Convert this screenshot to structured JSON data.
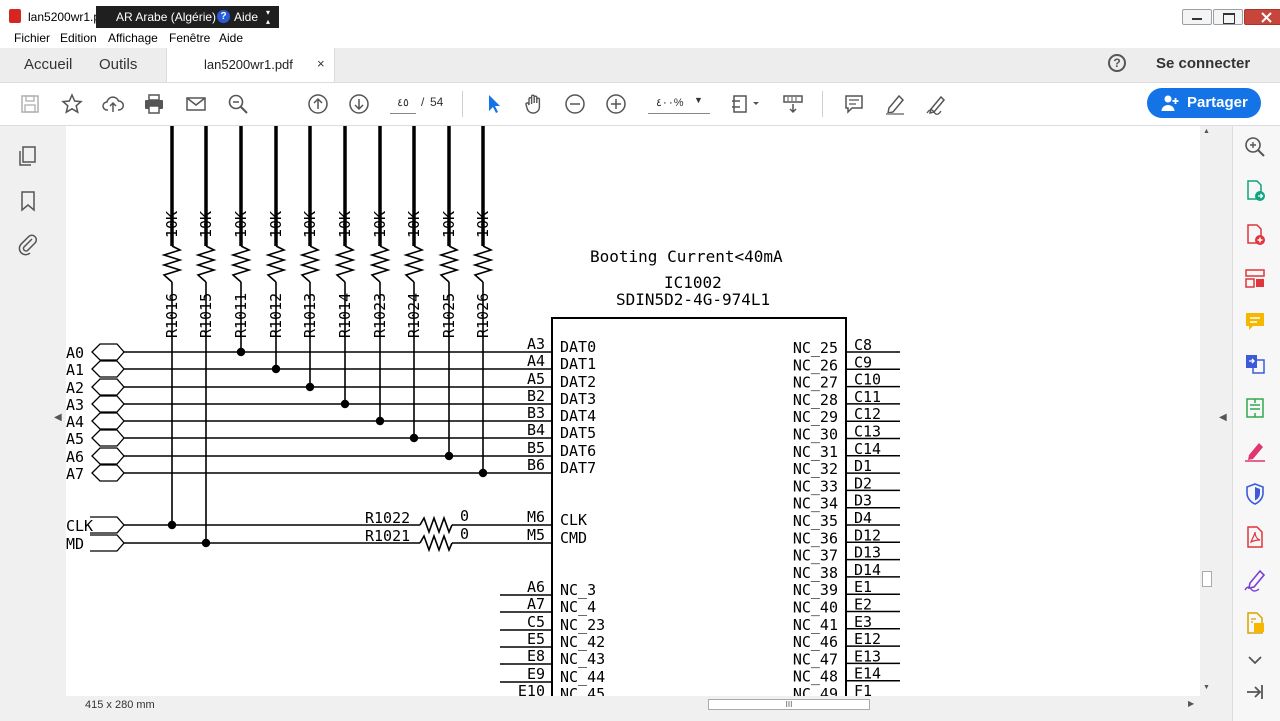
{
  "window": {
    "title": "lan5200wr1.pdf",
    "ime": {
      "language": "AR Arabe (Algérie)",
      "help": "Aide"
    }
  },
  "menu": [
    "Fichier",
    "Edition",
    "Affichage",
    "Fenêtre",
    "Aide"
  ],
  "tabs": {
    "home": "Accueil",
    "tools": "Outils",
    "document": "lan5200wr1.pdf",
    "close": "×"
  },
  "header": {
    "help": "?",
    "signin": "Se connecter"
  },
  "toolbar": {
    "page_current": "٤٥",
    "page_separator": "/",
    "page_total": "54",
    "zoom": "٤٠٠%",
    "share_label": "Partager"
  },
  "status": {
    "page_size": "415 x 280 mm",
    "hscroll_grip": "III"
  },
  "colors": {
    "accent": "#1473e6",
    "close": "#c6463c"
  },
  "schematic": {
    "note": "Booting Current<40mA",
    "ic_ref": "IC1002",
    "ic_part": "SDIN5D2-4G-974L1",
    "resistor_value": "10K",
    "pullups": [
      "R1016",
      "R1015",
      "R1011",
      "R1012",
      "R1013",
      "R1014",
      "R1023",
      "R1024",
      "R1025",
      "R1026"
    ],
    "net_labels": [
      "A0",
      "A1",
      "A2",
      "A3",
      "A4",
      "A5",
      "A6",
      "A7",
      "CLK",
      "MD"
    ],
    "left_pins": [
      {
        "ball": "A3",
        "name": "DAT0"
      },
      {
        "ball": "A4",
        "name": "DAT1"
      },
      {
        "ball": "A5",
        "name": "DAT2"
      },
      {
        "ball": "B2",
        "name": "DAT3"
      },
      {
        "ball": "B3",
        "name": "DAT4"
      },
      {
        "ball": "B4",
        "name": "DAT5"
      },
      {
        "ball": "B5",
        "name": "DAT6"
      },
      {
        "ball": "B6",
        "name": "DAT7"
      },
      {
        "ball": "M6",
        "name": "CLK"
      },
      {
        "ball": "M5",
        "name": "CMD"
      },
      {
        "ball": "A6",
        "name": "NC_3"
      },
      {
        "ball": "A7",
        "name": "NC_4"
      },
      {
        "ball": "C5",
        "name": "NC_23"
      },
      {
        "ball": "E5",
        "name": "NC_42"
      },
      {
        "ball": "E8",
        "name": "NC_43"
      },
      {
        "ball": "E9",
        "name": "NC_44"
      },
      {
        "ball": "E10",
        "name": "NC_45"
      }
    ],
    "series_resistors": [
      {
        "ref": "R1022",
        "value": "0"
      },
      {
        "ref": "R1021",
        "value": "0"
      }
    ],
    "right_pins": [
      {
        "name": "NC_25",
        "ball": "C8"
      },
      {
        "name": "NC_26",
        "ball": "C9"
      },
      {
        "name": "NC_27",
        "ball": "C10"
      },
      {
        "name": "NC_28",
        "ball": "C11"
      },
      {
        "name": "NC_29",
        "ball": "C12"
      },
      {
        "name": "NC_30",
        "ball": "C13"
      },
      {
        "name": "NC_31",
        "ball": "C14"
      },
      {
        "name": "NC_32",
        "ball": "D1"
      },
      {
        "name": "NC_33",
        "ball": "D2"
      },
      {
        "name": "NC_34",
        "ball": "D3"
      },
      {
        "name": "NC_35",
        "ball": "D4"
      },
      {
        "name": "NC_36",
        "ball": "D12"
      },
      {
        "name": "NC_37",
        "ball": "D13"
      },
      {
        "name": "NC_38",
        "ball": "D14"
      },
      {
        "name": "NC_39",
        "ball": "E1"
      },
      {
        "name": "NC_40",
        "ball": "E2"
      },
      {
        "name": "NC_41",
        "ball": "E3"
      },
      {
        "name": "NC_46",
        "ball": "E12"
      },
      {
        "name": "NC_47",
        "ball": "E13"
      },
      {
        "name": "NC_48",
        "ball": "E14"
      },
      {
        "name": "NC_49",
        "ball": "F1"
      }
    ]
  }
}
